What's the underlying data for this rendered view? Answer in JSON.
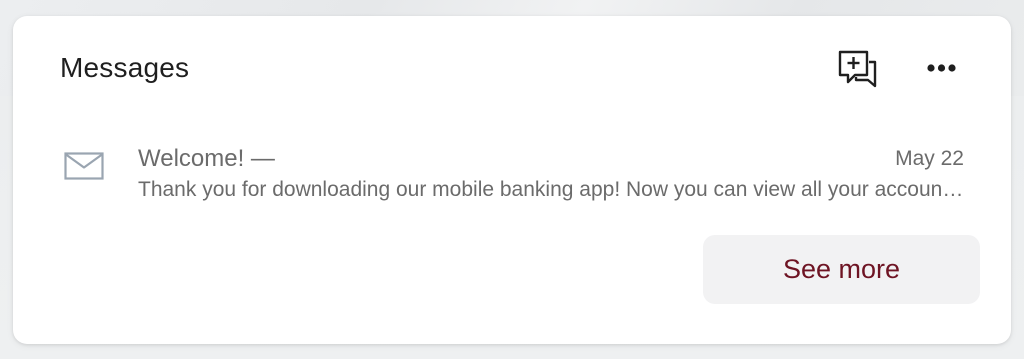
{
  "messages_card": {
    "title": "Messages",
    "compose_icon": "compose-message-icon",
    "more_icon": "more-horizontal-icon",
    "items": [
      {
        "icon": "envelope-icon",
        "subject": "Welcome! —",
        "date": "May 22",
        "preview": "Thank you for downloading our mobile banking app! Now you can view all your accounts, deposit checks, and more."
      }
    ],
    "see_more_label": "See more"
  },
  "colors": {
    "accent": "#6E1423",
    "text_primary": "#1F1F1F",
    "text_secondary": "#6B6B6B",
    "icon_muted": "#9AA5B1",
    "button_bg": "#F2F2F3"
  }
}
